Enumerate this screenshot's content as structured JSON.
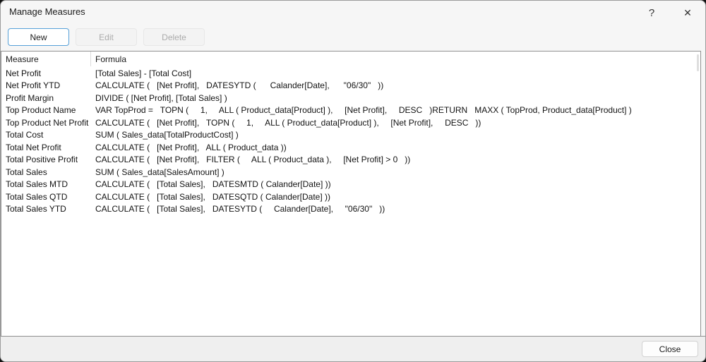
{
  "dialog": {
    "title": "Manage Measures",
    "help_label": "?",
    "close_x_label": "✕"
  },
  "toolbar": {
    "new_label": "New",
    "edit_label": "Edit",
    "delete_label": "Delete"
  },
  "table": {
    "columns": [
      "Measure",
      "Formula"
    ],
    "rows": [
      {
        "measure": "Net Profit",
        "formula": "[Total Sales] - [Total Cost]"
      },
      {
        "measure": "Net Profit YTD",
        "formula": "CALCULATE (   [Net Profit],   DATESYTD (      Calander[Date],      \"06/30\"   ))"
      },
      {
        "measure": "Profit Margin",
        "formula": "DIVIDE ( [Net Profit], [Total Sales] )"
      },
      {
        "measure": "Top Product Name",
        "formula": "VAR TopProd =   TOPN (     1,     ALL ( Product_data[Product] ),     [Net Profit],     DESC   )RETURN   MAXX ( TopProd, Product_data[Product] )"
      },
      {
        "measure": "Top Product Net Profit",
        "formula": "CALCULATE (   [Net Profit],   TOPN (     1,     ALL ( Product_data[Product] ),     [Net Profit],     DESC   ))"
      },
      {
        "measure": "Total Cost",
        "formula": "SUM ( Sales_data[TotalProductCost] )"
      },
      {
        "measure": "Total Net Profit",
        "formula": "CALCULATE (   [Net Profit],   ALL ( Product_data ))"
      },
      {
        "measure": "Total Positive Profit",
        "formula": "CALCULATE (   [Net Profit],   FILTER (     ALL ( Product_data ),     [Net Profit] > 0   ))"
      },
      {
        "measure": "Total Sales",
        "formula": "SUM ( Sales_data[SalesAmount] )"
      },
      {
        "measure": "Total Sales MTD",
        "formula": "CALCULATE (   [Total Sales],   DATESMTD ( Calander[Date] ))"
      },
      {
        "measure": "Total Sales QTD",
        "formula": "CALCULATE (   [Total Sales],   DATESQTD ( Calander[Date] ))"
      },
      {
        "measure": "Total Sales YTD",
        "formula": "CALCULATE (   [Total Sales],   DATESYTD (     Calander[Date],     \"06/30\"   ))"
      }
    ]
  },
  "footer": {
    "close_label": "Close"
  },
  "colors": {
    "accent_border": "#56a0d8",
    "dialog_bg": "#f6f6f6",
    "list_bg": "#ffffff",
    "footer_bg": "#efefef",
    "disabled_text": "#ababab"
  }
}
